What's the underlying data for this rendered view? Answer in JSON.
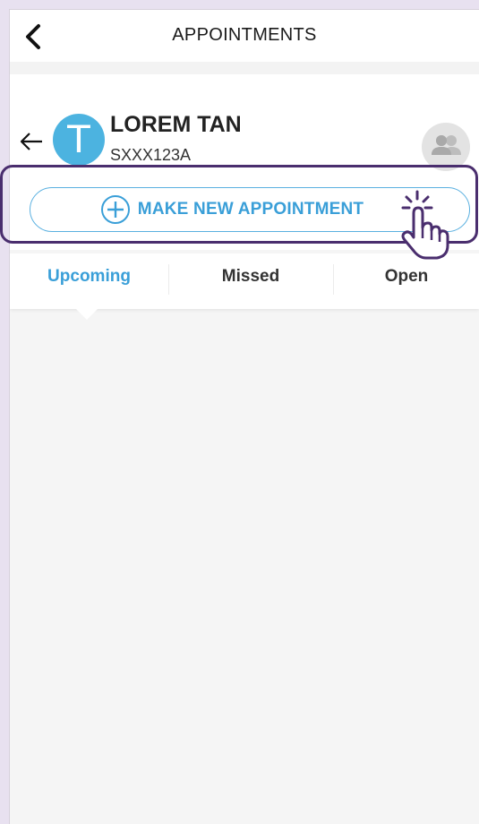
{
  "header": {
    "title": "APPOINTMENTS"
  },
  "profile": {
    "initial": "T",
    "name": "LOREM TAN",
    "id": "SXXX123A"
  },
  "action": {
    "label": "MAKE NEW APPOINTMENT"
  },
  "tabs": [
    {
      "label": "Upcoming",
      "active": true
    },
    {
      "label": "Missed",
      "active": false
    },
    {
      "label": "Open",
      "active": false
    }
  ],
  "colors": {
    "accent": "#3a9fd8",
    "avatar": "#4cb3e0",
    "highlight_border": "#4a2e6e",
    "backdrop": "#e8e1f0"
  },
  "icons": [
    "chevron-left-icon",
    "arrow-left-icon",
    "group-icon",
    "plus-circle-icon",
    "hand-pointer-icon"
  ]
}
